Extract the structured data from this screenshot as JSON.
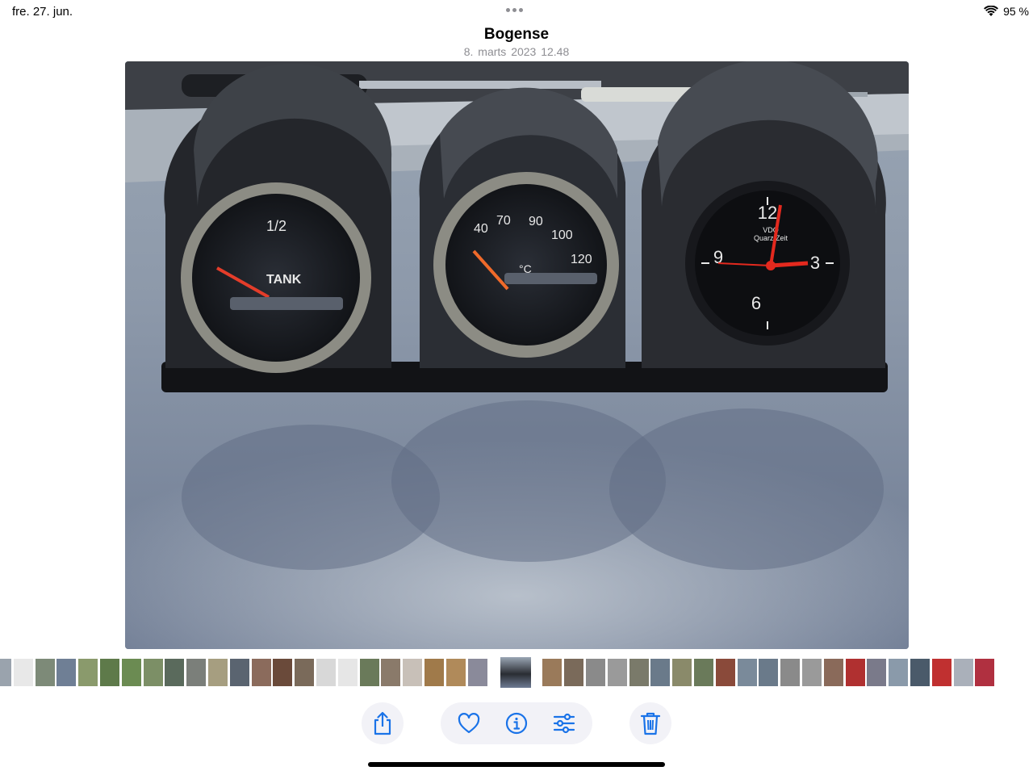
{
  "status_bar": {
    "date": "fre. 27. jun.",
    "battery": "95 %"
  },
  "header": {
    "title": "Bogense",
    "subtitle": "8. marts 2023  12.48"
  },
  "photo": {
    "description_labels": {
      "tank_label": "TANK",
      "tank_half": "1/2",
      "temp_marks": [
        "40",
        "70",
        "90",
        "100",
        "120"
      ],
      "temp_unit": "°C",
      "clock_brand": "VDO",
      "clock_sub": "Quarz Zeit",
      "clock_12": "12",
      "clock_3": "3",
      "clock_6": "6",
      "clock_9": "9",
      "vdo": "VDO"
    }
  },
  "filmstrip": {
    "colors": [
      "#9aa3ad",
      "#e8e8e8",
      "#7d8a78",
      "#6f7f95",
      "#8a9a6c",
      "#5e7a4a",
      "#6b8b52",
      "#7c8f66",
      "#5a6a5c",
      "#7b7f7a",
      "#a69e80",
      "#5a6470",
      "#8b6b5c",
      "#6a4a3a",
      "#7a6a5a",
      "#d8d8d8",
      "#e6e6e6",
      "#6a7a5a",
      "#8a7a6a",
      "#c8c0b8",
      "#a07a4a",
      "#b08a5a",
      "#8a8a9a",
      "#5a6a7a",
      "#9a7a5a",
      "#7a6a5a",
      "#8a8a8a",
      "#9a9a9a",
      "#7a7a6a",
      "#6a7a8a",
      "#8a8a6a",
      "#6a7a5a",
      "#8a4a3a",
      "#7a8a9a",
      "#6a7a8a",
      "#8a8a8a",
      "#9a9a9a",
      "#8a6a5a",
      "#b03030",
      "#7a7a8a",
      "#8a9aaa",
      "#4a5a6a",
      "#c03030",
      "#aab0ba",
      "#b03040"
    ],
    "icons": {
      "current": "current-photo"
    }
  },
  "toolbar": {
    "share": "share-icon",
    "favorite": "heart-icon",
    "info": "info-icon",
    "adjust": "adjust-icon",
    "delete": "trash-icon",
    "accent": "#1a73e8"
  }
}
